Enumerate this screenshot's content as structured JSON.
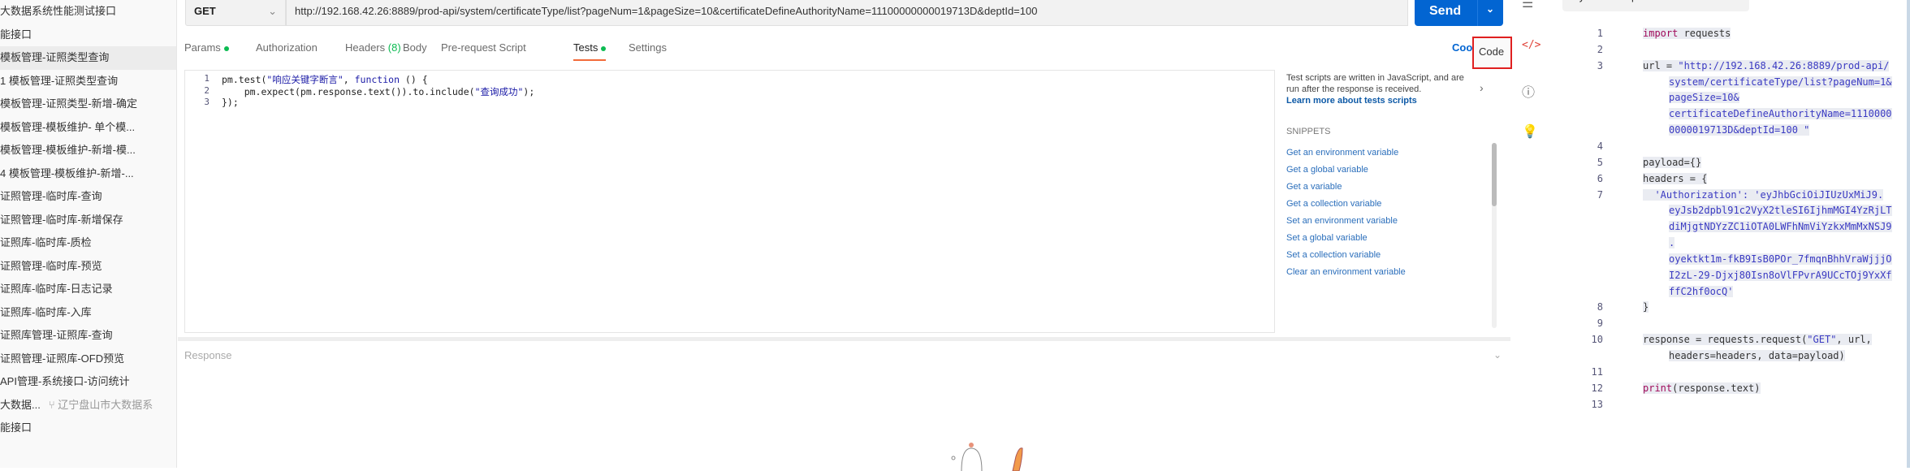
{
  "sidebar": {
    "items": [
      {
        "label": "大数据系统性能测试接口"
      },
      {
        "label": "能接口"
      },
      {
        "label": "模板管理-证照类型查询",
        "selected": true
      },
      {
        "label": "1 模板管理-证照类型查询"
      },
      {
        "label": "模板管理-证照类型-新增-确定"
      },
      {
        "label": "模板管理-模板维护- 单个模..."
      },
      {
        "label": "模板管理-模板维护-新增-模..."
      },
      {
        "label": "4 模板管理-模板维护-新增-..."
      },
      {
        "label": "证照管理-临时库-查询"
      },
      {
        "label": "证照管理-临时库-新增保存"
      },
      {
        "label": "证照库-临时库-质检"
      },
      {
        "label": "证照管理-临时库-预览"
      },
      {
        "label": "证照库-临时库-日志记录"
      },
      {
        "label": " 证照库-临时库-入库"
      },
      {
        "label": " 证照库管理-证照库-查询"
      },
      {
        "label": " 证照管理-证照库-OFD预览"
      },
      {
        "label": " API管理-系统接口-访问统计"
      },
      {
        "label": "大数据...",
        "fork": "辽宁盘山市大数据系"
      },
      {
        "label": "能接口"
      }
    ]
  },
  "request": {
    "method": "GET",
    "url": "http://192.168.42.26:8889/prod-api/system/certificateType/list?pageNum=1&pageSize=10&certificateDefineAuthorityName=11100000000019713D&deptId=100",
    "send_label": "Send"
  },
  "tabs": [
    {
      "label": "Params",
      "dot": true
    },
    {
      "label": "Authorization"
    },
    {
      "label": "Headers",
      "count": "(8)"
    },
    {
      "label": "Body"
    },
    {
      "label": "Pre-request Script"
    },
    {
      "label": "Tests",
      "dot": true,
      "active": true
    },
    {
      "label": "Settings"
    }
  ],
  "cookies_label": "Coo",
  "code_tooltip": "Code",
  "editor": {
    "lines": [
      {
        "n": "1",
        "pre": "pm.test(",
        "str": "\"响应关键字断言\"",
        "mid": ", ",
        "kw": "function",
        "post": " () {"
      },
      {
        "n": "2",
        "pre": "    pm.expect(pm.response.text()).to.include(",
        "str": "\"查询成功\"",
        "mid": ");",
        "kw": "",
        "post": ""
      },
      {
        "n": "3",
        "pre": "});",
        "str": "",
        "mid": "",
        "kw": "",
        "post": ""
      }
    ]
  },
  "snippets": {
    "description": "Test scripts are written in JavaScript, and are run after the response is received.",
    "learn_more": "Learn more about tests scripts",
    "title": "SNIPPETS",
    "items": [
      "Get an environment variable",
      "Get a global variable",
      "Get a variable",
      "Get a collection variable",
      "Set an environment variable",
      "Set a global variable",
      "Set a collection variable",
      "Clear an environment variable"
    ]
  },
  "response": {
    "label": "Response"
  },
  "code_panel": {
    "language": "Python - Requests",
    "lines": [
      {
        "n": "1",
        "parts": [
          {
            "t": "import",
            "c": "kw"
          },
          {
            "t": " requests",
            "c": ""
          }
        ]
      },
      {
        "n": "2",
        "parts": []
      },
      {
        "n": "3",
        "parts": [
          {
            "t": "url = ",
            "c": ""
          },
          {
            "t": "\"http://192.168.42.26:8889/prod-api/",
            "c": "st"
          }
        ]
      },
      {
        "n": "",
        "indent": true,
        "parts": [
          {
            "t": "system/certificateType/list?pageNum=1&",
            "c": "st"
          }
        ]
      },
      {
        "n": "",
        "indent": true,
        "parts": [
          {
            "t": "pageSize=10&",
            "c": "st"
          }
        ]
      },
      {
        "n": "",
        "indent": true,
        "parts": [
          {
            "t": "certificateDefineAuthorityName=1110000",
            "c": "st"
          }
        ]
      },
      {
        "n": "",
        "indent": true,
        "parts": [
          {
            "t": "0000019713D&deptId=100 \"",
            "c": "st"
          }
        ]
      },
      {
        "n": "4",
        "parts": []
      },
      {
        "n": "5",
        "parts": [
          {
            "t": "payload={}",
            "c": ""
          }
        ]
      },
      {
        "n": "6",
        "parts": [
          {
            "t": "headers = {",
            "c": ""
          }
        ]
      },
      {
        "n": "7",
        "parts": [
          {
            "t": "  'Authorization': 'eyJhbGciOiJIUzUxMiJ9.",
            "c": "st"
          }
        ]
      },
      {
        "n": "",
        "indent": true,
        "parts": [
          {
            "t": "eyJsb2dpbl91c2VyX2tleSI6IjhmMGI4YzRjLT",
            "c": "st"
          }
        ]
      },
      {
        "n": "",
        "indent": true,
        "parts": [
          {
            "t": "diMjgtNDYzZC1iOTA0LWFhNmViYzkxMmMxNSJ9",
            "c": "st"
          }
        ]
      },
      {
        "n": "",
        "indent": true,
        "parts": [
          {
            "t": ".",
            "c": "st"
          }
        ]
      },
      {
        "n": "",
        "indent": true,
        "parts": [
          {
            "t": "oyektkt1m-fkB9IsB0POr_7fmqnBhhVraWjjjO",
            "c": "st"
          }
        ]
      },
      {
        "n": "",
        "indent": true,
        "parts": [
          {
            "t": "I2zL-29-Djxj80Isn8oVlFPvrA9UCcTOj9YxXf",
            "c": "st"
          }
        ]
      },
      {
        "n": "",
        "indent": true,
        "parts": [
          {
            "t": "ffC2hf0ocQ'",
            "c": "st"
          }
        ]
      },
      {
        "n": "8",
        "parts": [
          {
            "t": "}",
            "c": ""
          }
        ]
      },
      {
        "n": "9",
        "parts": []
      },
      {
        "n": "10",
        "parts": [
          {
            "t": "response = requests.request(",
            "c": ""
          },
          {
            "t": "\"GET\"",
            "c": "st"
          },
          {
            "t": ", url,",
            "c": ""
          }
        ]
      },
      {
        "n": "",
        "indent": true,
        "parts": [
          {
            "t": "headers=headers, data=payload)",
            "c": ""
          }
        ]
      },
      {
        "n": "11",
        "parts": []
      },
      {
        "n": "12",
        "parts": [
          {
            "t": "print",
            "c": "kw"
          },
          {
            "t": "(response.text)",
            "c": ""
          }
        ]
      },
      {
        "n": "13",
        "parts": []
      }
    ]
  },
  "colors": {
    "accent": "#0265d2",
    "tab_underline": "#f26b3a",
    "status_dot": "#0cbb52",
    "highlight_box": "#e02020"
  }
}
